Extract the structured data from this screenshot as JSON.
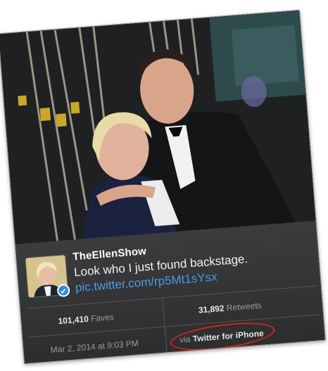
{
  "tweet": {
    "handle": "TheEllenShow",
    "text_plain": "Look who I just found backstage.",
    "text_link": "pic.twitter.com/rp5Mt1sYsx",
    "verified_badge": "✔"
  },
  "stats": {
    "faves_count": "101,410",
    "faves_label": "Faves",
    "retweets_count": "31,892",
    "retweets_label": "Retweets",
    "date": "Mar 2, 2014 at 9:03 PM",
    "via_prefix": "via",
    "via_app": "Twitter for iPhone"
  },
  "colors": {
    "link": "#4a9be6",
    "highlight_oval": "#d6241b",
    "card_bg": "#2b2c2e"
  },
  "icons": {
    "verified": "verified-check-icon",
    "avatar": "profile-avatar"
  }
}
